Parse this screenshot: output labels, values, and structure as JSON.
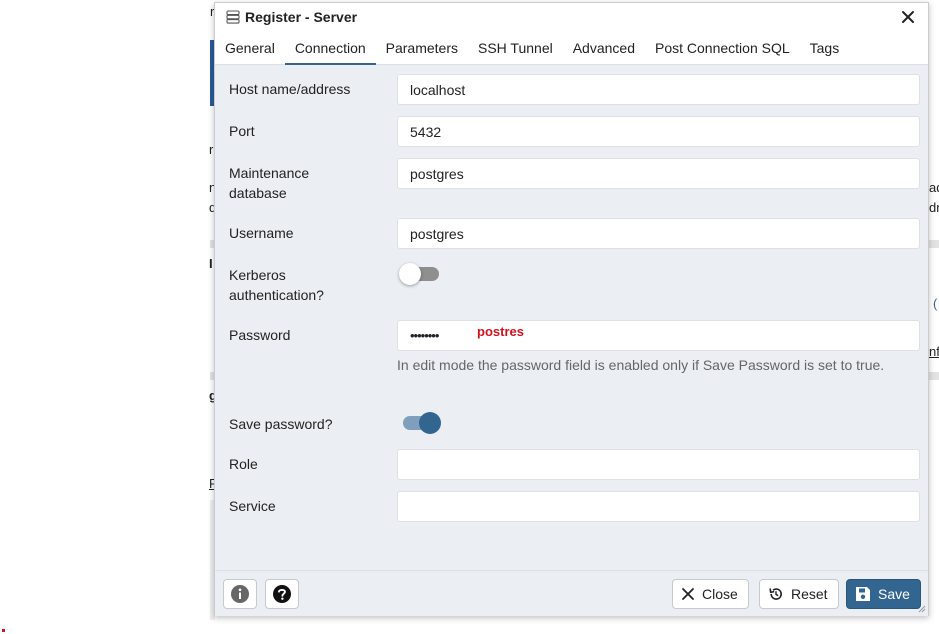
{
  "dialog": {
    "title": "Register - Server",
    "close_icon": "close-icon",
    "tabs": [
      {
        "label": "General",
        "active": false
      },
      {
        "label": "Connection",
        "active": true
      },
      {
        "label": "Parameters",
        "active": false
      },
      {
        "label": "SSH Tunnel",
        "active": false
      },
      {
        "label": "Advanced",
        "active": false
      },
      {
        "label": "Post Connection SQL",
        "active": false
      },
      {
        "label": "Tags",
        "active": false
      }
    ]
  },
  "form": {
    "host": {
      "label": "Host name/address",
      "value": "localhost"
    },
    "port": {
      "label": "Port",
      "value": "5432"
    },
    "maintenance_db": {
      "label": "Maintenance database",
      "value": "postgres"
    },
    "username": {
      "label": "Username",
      "value": "postgres"
    },
    "kerberos": {
      "label": "Kerberos authentication?",
      "enabled": false
    },
    "password": {
      "label": "Password",
      "value": "••••••••",
      "annotation": "postres"
    },
    "password_hint": "In edit mode the password field is enabled only if Save Password is set to true.",
    "save_password": {
      "label": "Save password?",
      "enabled": true
    },
    "role": {
      "label": "Role",
      "value": ""
    },
    "service": {
      "label": "Service",
      "value": ""
    }
  },
  "footer": {
    "info_icon": "info-icon",
    "help_icon": "help-icon",
    "close_label": "Close",
    "reset_label": "Reset",
    "save_label": "Save"
  },
  "colors": {
    "accent": "#326690",
    "dialog_bg": "#ebeef2",
    "annotation": "#d0121f"
  }
}
